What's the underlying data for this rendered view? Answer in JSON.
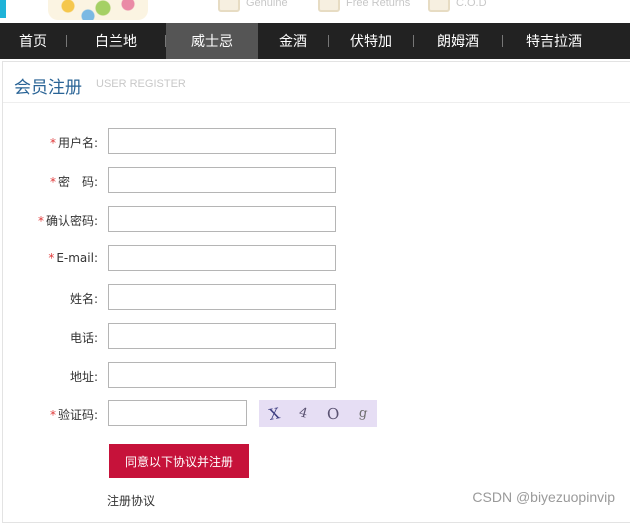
{
  "header": {
    "promos": [
      {
        "icon": "shield-icon",
        "label": "Genuine"
      },
      {
        "icon": "shield-icon",
        "label": "Free Returns"
      },
      {
        "icon": "box-icon",
        "label": "C.O.D"
      }
    ]
  },
  "nav": {
    "items": [
      {
        "label": "首页"
      },
      {
        "label": "白兰地"
      },
      {
        "label": "威士忌",
        "active": true
      },
      {
        "label": "金酒"
      },
      {
        "label": "伏特加"
      },
      {
        "label": "朗姆酒"
      },
      {
        "label": "特吉拉酒"
      }
    ]
  },
  "register": {
    "title": "会员注册",
    "subtitle": "USER REGISTER",
    "fields": [
      {
        "label": "用户名:",
        "required": true,
        "value": ""
      },
      {
        "label": "密　码:",
        "required": true,
        "value": ""
      },
      {
        "label": "确认密码:",
        "required": true,
        "value": ""
      },
      {
        "label": "E-mail:",
        "required": true,
        "value": ""
      },
      {
        "label": "姓名:",
        "required": false,
        "value": ""
      },
      {
        "label": "电话:",
        "required": false,
        "value": ""
      },
      {
        "label": "地址:",
        "required": false,
        "value": ""
      }
    ],
    "captcha": {
      "label": "验证码:",
      "required": true,
      "value": "",
      "image_text": [
        "X",
        "4",
        "O",
        "g"
      ]
    },
    "required_mark": "*",
    "submit_label": "同意以下协议并注册",
    "agreement_link": "注册协议"
  },
  "watermark": "CSDN @biyezuopinvip"
}
